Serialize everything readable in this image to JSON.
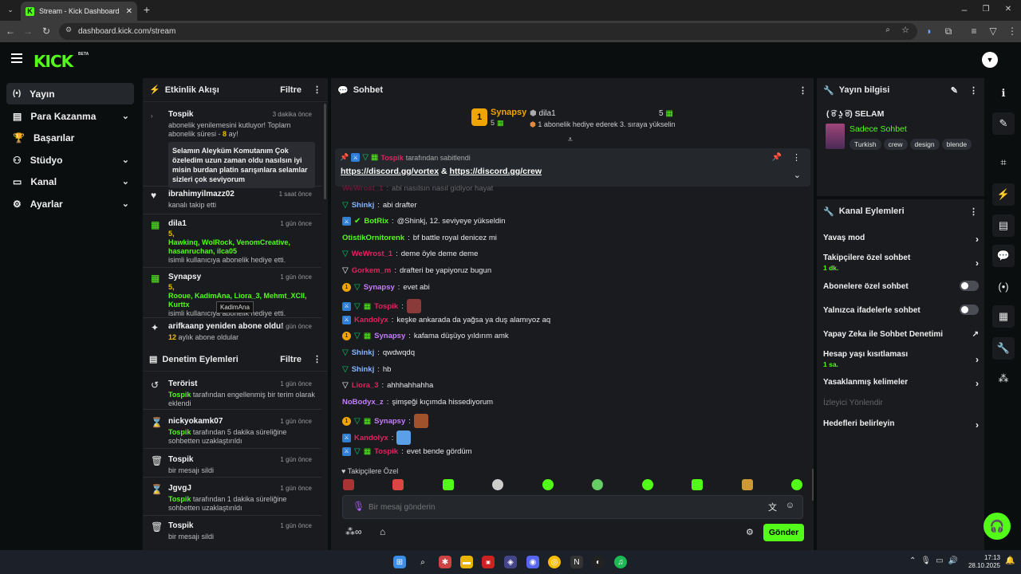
{
  "browser": {
    "tab_title": "Stream - Kick Dashboard",
    "url": "dashboard.kick.com/stream"
  },
  "topnav": {
    "logo": "KICK",
    "beta": "BETA"
  },
  "leftnav": {
    "items": [
      {
        "label": "Yayın",
        "icon": "broadcast-icon",
        "active": true
      },
      {
        "label": "Para Kazanma",
        "icon": "wallet-icon",
        "chevron": true
      },
      {
        "label": "Başarılar",
        "icon": "trophy-icon"
      },
      {
        "label": "Stüdyo",
        "icon": "studio-icon",
        "chevron": true
      },
      {
        "label": "Kanal",
        "icon": "tv-icon",
        "chevron": true
      },
      {
        "label": "Ayarlar",
        "icon": "gear-icon",
        "chevron": true
      }
    ]
  },
  "activity": {
    "title": "Etkinlik Akışı",
    "filter": "Filtre",
    "events": [
      {
        "user": "Tospik",
        "time": "3 dakika önce",
        "text": "abonelik yenilemesini kutluyor! Toplam abonelik süresi -",
        "months": "8",
        "months_suffix": "ay!",
        "message": "Selamın Aleyküm Komutanım Çok özeledim uzun zaman oldu nasılsın iyi misin burdan platin sarışınlara selamlar sizleri çok seviyorum"
      },
      {
        "user": "ibrahimyilmazz02",
        "time": "1 saat önce",
        "text": "kanalı takip etti"
      },
      {
        "user": "dila1",
        "time": "1 gün önce",
        "count": "5,",
        "names": "Hawkinq, WolRock, VenomCreative, hasanruchan, ilca05",
        "text": "isimli kullanıcıya abonelik hediye etti."
      },
      {
        "user": "Synapsy",
        "time": "1 gün önce",
        "count": "5,",
        "names": "Rooue, KadimAna, Liora_3, Mehmt_XCII, Kurttx",
        "text": "isimli kullanıcıya abonelik hediye etti.",
        "tooltip": "KadimAna"
      },
      {
        "user": "arifkaanp yeniden abone oldu!",
        "time": "1 gün önce",
        "months": "12",
        "text": "aylık abone oldular"
      }
    ]
  },
  "moderation": {
    "title": "Denetim Eylemleri",
    "filter": "Filtre",
    "events": [
      {
        "user": "Terörist",
        "time": "1 gün önce",
        "actor": "Tospik",
        "text": "tarafından engellenmiş bir terim olarak eklendi"
      },
      {
        "user": "nickyokamk07",
        "time": "1 gün önce",
        "actor": "Tospik",
        "text": "tarafından 5 dakika süreliğine sohbetten uzaklaştırıldı"
      },
      {
        "user": "Tospik",
        "time": "1 gün önce",
        "text": "bir mesajı sildi"
      },
      {
        "user": "JgvgJ",
        "time": "1 gün önce",
        "actor": "Tospik",
        "text": "tarafından 1 dakika süreliğine sohbetten uzaklaştırıldı"
      },
      {
        "user": "Tospik",
        "time": "1 gün önce",
        "text": "bir mesajı sildi"
      }
    ]
  },
  "chat": {
    "title": "Sohbet",
    "leaderboard": {
      "first_user": "Synapsy",
      "first_count": "5",
      "first_rank": "1",
      "second_user": "dila1",
      "second_count": "5",
      "hint": "1 abonelik hediye ederek 3. sıraya yükselin"
    },
    "pinned": {
      "by_user": "Tospik",
      "by_text": "tarafından sabitlendi",
      "link1": "https://discord.gg/vortex",
      "amp": "&",
      "link2": "https://discord.gg/crew"
    },
    "messages": [
      {
        "user": "WeWrost_1",
        "color": "#e0245e",
        "text": "abi nasılsın nasıl gidiyor hayat"
      },
      {
        "user": "Shinkj",
        "color": "#8ab4f8",
        "text": "abi drafter",
        "badges": [
          "og"
        ]
      },
      {
        "user": "BotRix",
        "color": "#53fc18",
        "text": "@Shinkj, 12. seviyeye yükseldin",
        "badges": [
          "mod",
          "ver"
        ]
      },
      {
        "user": "OtistikOrnitorenk",
        "color": "#53fc18",
        "text": "bf battle royal denicez mi",
        "badges": []
      },
      {
        "user": "WeWrost_1",
        "color": "#e0245e",
        "text": "deme öyle deme deme",
        "badges": [
          "og"
        ]
      },
      {
        "user": "Gorkem_m",
        "color": "#e0245e",
        "text": "drafteri be yapiyoruz bugun",
        "badges": [
          "og2"
        ]
      },
      {
        "user": "Synapsy",
        "color": "#c77dff",
        "text": "evet abi",
        "badges": [
          "sub",
          "og"
        ]
      },
      {
        "user": "Tospik",
        "color": "#e0245e",
        "text": "",
        "badges": [
          "mod",
          "og",
          "gift"
        ],
        "emote": "#8b3a3a"
      },
      {
        "user": "Kandolyx",
        "color": "#e0245e",
        "text": "keşke ankarada da yağsa ya duş alamıyoz aq",
        "badges": [
          "mod"
        ]
      },
      {
        "user": "Synapsy",
        "color": "#c77dff",
        "text": "kafama düşüyo yıldırım amk",
        "badges": [
          "sub",
          "og",
          "gift"
        ]
      },
      {
        "user": "Shinkj",
        "color": "#8ab4f8",
        "text": "qwdwqdq",
        "badges": [
          "og"
        ]
      },
      {
        "user": "Shinkj",
        "color": "#8ab4f8",
        "text": "hb",
        "badges": [
          "og"
        ]
      },
      {
        "user": "Liora_3",
        "color": "#e0245e",
        "text": "ahhhahhahha",
        "badges": [
          "og2"
        ]
      },
      {
        "user": "NoBodyx_z",
        "color": "#c77dff",
        "text": "şimşeği kıçımda hissediyorum",
        "badges": []
      },
      {
        "user": "Synapsy",
        "color": "#c77dff",
        "text": "",
        "badges": [
          "sub",
          "og",
          "gift"
        ],
        "emote": "#a0522d"
      },
      {
        "user": "Kandolyx",
        "color": "#e0245e",
        "text": "",
        "badges": [
          "mod"
        ],
        "emote": "#5aa0e6"
      },
      {
        "user": "Tospik",
        "color": "#e0245e",
        "text": "evet bende gördüm",
        "badges": [
          "mod",
          "og",
          "gift"
        ]
      }
    ],
    "emote_bar_label": "Takipçilere Özel",
    "input_placeholder": "Bir mesaj gönderin",
    "send": "Gönder"
  },
  "stream_info": {
    "title": "Yayın bilgisi",
    "stream_title": "( ͡ಠ ʖ̯ ͡ಠ) SELAM",
    "category": "Sadece Sohbet",
    "tags": [
      "Turkish",
      "crew",
      "design",
      "blende"
    ]
  },
  "channel_actions": {
    "title": "Kanal Eylemleri",
    "rows": [
      {
        "label": "Yavaş mod",
        "type": "arrow"
      },
      {
        "label": "Takipçilere özel sohbet",
        "sub": "1 dk.",
        "type": "arrow"
      },
      {
        "label": "Abonelere özel sohbet",
        "type": "toggle"
      },
      {
        "label": "Yalnızca ifadelerle sohbet",
        "type": "toggle"
      },
      {
        "label": "Yapay Zeka ile Sohbet Denetimi",
        "type": "external"
      },
      {
        "label": "Hesap yaşı kısıtlaması",
        "sub": "1 sa.",
        "type": "arrow"
      },
      {
        "label": "Yasaklanmış kelimeler",
        "type": "arrow"
      },
      {
        "label": "İzleyici Yönlendir",
        "type": "disabled"
      },
      {
        "label": "Hedefleri belirleyin",
        "type": "arrow"
      }
    ]
  },
  "taskbar": {
    "time": "17:13",
    "date": "28.10.2025"
  },
  "colors": {
    "brand": "#53fc18",
    "panel": "#191b1f",
    "bg": "#0b0e0f"
  }
}
